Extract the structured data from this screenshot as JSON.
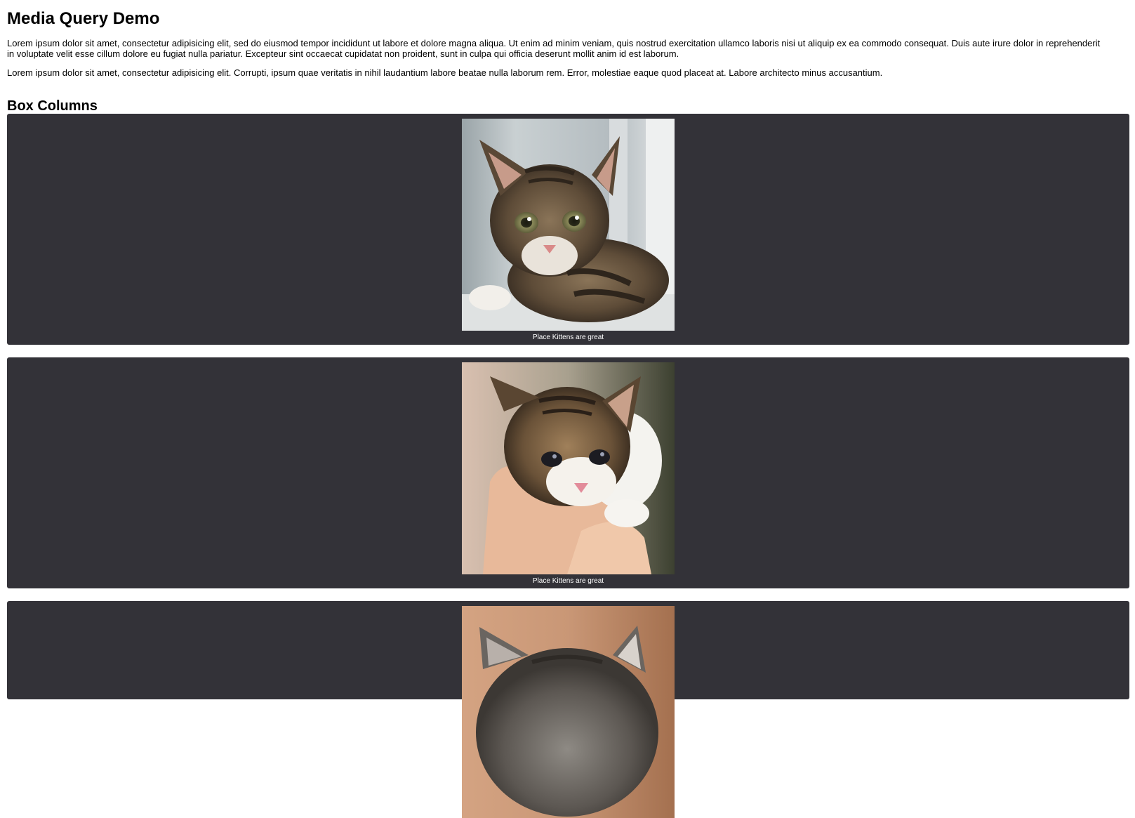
{
  "page": {
    "title": "Media Query Demo",
    "paragraphs": [
      "Lorem ipsum dolor sit amet, consectetur adipisicing elit, sed do eiusmod tempor incididunt ut labore et dolore magna aliqua. Ut enim ad minim veniam, quis nostrud exercitation ullamco laboris nisi ut aliquip ex ea commodo consequat. Duis aute irure dolor in reprehenderit in voluptate velit esse cillum dolore eu fugiat nulla pariatur. Excepteur sint occaecat cupidatat non proident, sunt in culpa qui officia deserunt mollit anim id est laborum.",
      "Lorem ipsum dolor sit amet, consectetur adipisicing elit. Corrupti, ipsum quae veritatis in nihil laudantium labore beatae nulla laborum rem. Error, molestiae eaque quod placeat at. Labore architecto minus accusantium."
    ],
    "section_heading": "Box Columns"
  },
  "boxes": [
    {
      "caption": "Place Kittens are great",
      "image": "kitten-photo"
    },
    {
      "caption": "Place Kittens are great",
      "image": "kitten-photo"
    },
    {
      "caption": "",
      "image": "kitten-photo"
    }
  ],
  "colors": {
    "box_background": "#333238",
    "caption_text": "#ffffff",
    "page_background": "#ffffff"
  }
}
